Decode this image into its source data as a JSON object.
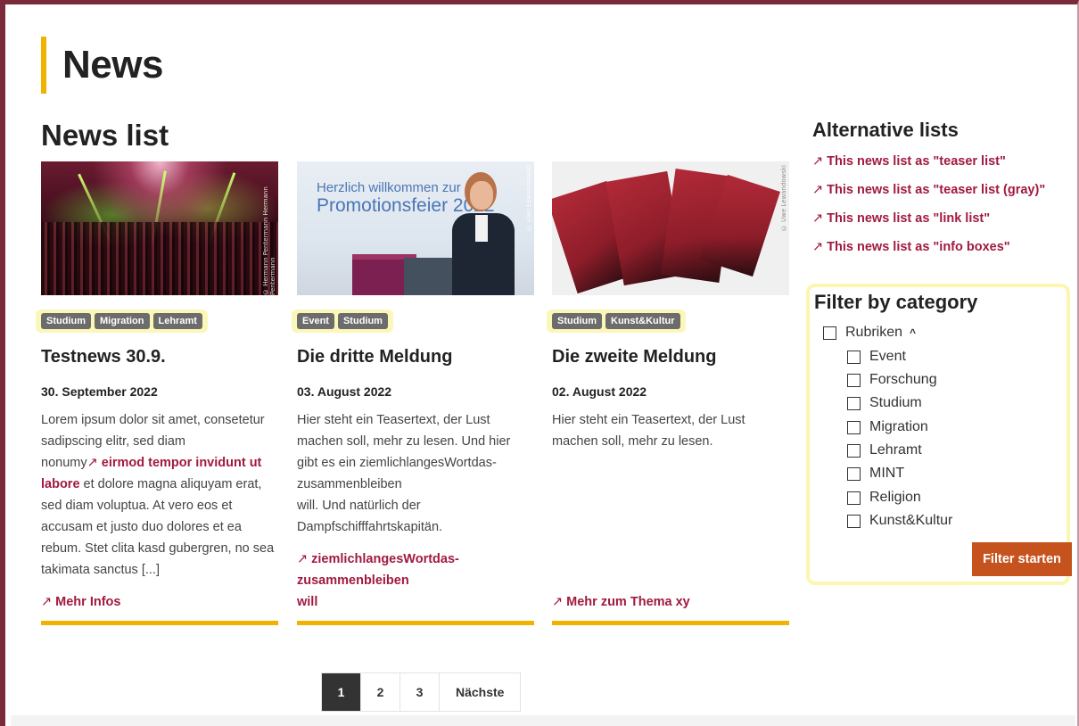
{
  "page": {
    "title": "News"
  },
  "news": {
    "section_title": "News list",
    "cards": [
      {
        "image_credit": "© Hermann Pentermann Hermann Pentermann",
        "tags": [
          "Studium",
          "Migration",
          "Lehramt"
        ],
        "title": "Testnews 30.9.",
        "date": "30. September 2022",
        "text_before": "Lorem ipsum dolor sit amet, consetetur sadipscing elitr, sed diam nonumy",
        "inline_link": "eirmod tempor invidunt ut labore",
        "text_after": " et dolore magna aliquyam erat, sed diam voluptua. At vero eos et accusam et justo duo dolores et ea rebum. Stet clita kasd gubergren, no sea takimata sanctus [...]",
        "link": "Mehr Infos"
      },
      {
        "image_credit": "© Uwe Lewandowski",
        "slide_line1": "Herzlich willkommen zur",
        "slide_line2": "Promotionsfeier 2022",
        "tags": [
          "Event",
          "Studium"
        ],
        "title": "Die dritte Meldung",
        "date": "03. August 2022",
        "text_line1": "Hier steht ein Teasertext, der Lust machen soll, mehr zu lesen. Und hier gibt es ein ziemlichlangesWortdas-zusammenbleiben",
        "text_line2": "will. Und natürlich der Dampfschifffahrtskapitän.",
        "link_line1": "ziemlichlangesWortdas-",
        "link_line2": "zusammenbleiben",
        "link_line3": "will"
      },
      {
        "image_credit": "© Uwe Lewandowski",
        "tags": [
          "Studium",
          "Kunst&Kultur"
        ],
        "title": "Die zweite Meldung",
        "date": "02. August 2022",
        "text": "Hier steht ein Teasertext, der Lust machen soll, mehr zu lesen.",
        "link": "Mehr zum Thema xy"
      }
    ]
  },
  "pagination": {
    "pages": [
      "1",
      "2",
      "3"
    ],
    "next": "Nächste",
    "active": "1"
  },
  "sidebar": {
    "alt_title": "Alternative lists",
    "alt_links": [
      "This news list as \"teaser list\"",
      "This news list as \"teaser list (gray)\"",
      "This news list as \"link list\"",
      "This news list as \"info boxes\""
    ],
    "filter": {
      "title": "Filter by category",
      "parent": "Rubriken",
      "parent_expanded_icon": "chevron-up-icon",
      "categories": [
        "Event",
        "Forschung",
        "Studium",
        "Migration",
        "Lehramt",
        "MINT",
        "Religion",
        "Kunst&Kultur"
      ],
      "button": "Filter starten"
    }
  },
  "colors": {
    "accent_yellow": "#f0b400",
    "link_red": "#a11a3f",
    "button_orange": "#c6531e",
    "frame": "#7a2a3a"
  },
  "icons": {
    "external_link": "external-link-icon"
  }
}
